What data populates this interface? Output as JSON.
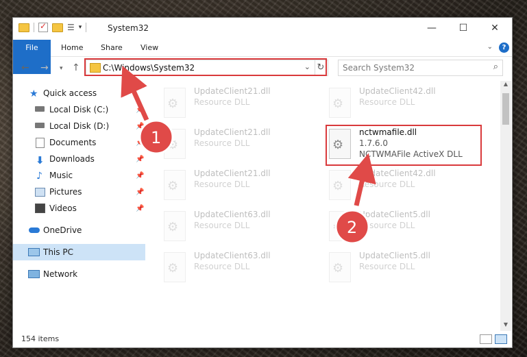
{
  "window": {
    "title": "System32"
  },
  "ribbon": {
    "tabs": [
      "File",
      "Home",
      "Share",
      "View"
    ],
    "help": "?"
  },
  "address": {
    "path": "C:\\Windows\\System32",
    "search_placeholder": "Search System32"
  },
  "sidebar": {
    "items": [
      {
        "label": "Quick access",
        "icon": "star-icon"
      },
      {
        "label": "Local Disk (C:)",
        "icon": "drive-icon"
      },
      {
        "label": "Local Disk (D:)",
        "icon": "drive-icon"
      },
      {
        "label": "Documents",
        "icon": "documents-icon"
      },
      {
        "label": "Downloads",
        "icon": "download-icon"
      },
      {
        "label": "Music",
        "icon": "music-icon"
      },
      {
        "label": "Pictures",
        "icon": "pictures-icon"
      },
      {
        "label": "Videos",
        "icon": "videos-icon"
      },
      {
        "label": "OneDrive",
        "icon": "cloud-icon"
      },
      {
        "label": "This PC",
        "icon": "computer-icon"
      },
      {
        "label": "Network",
        "icon": "network-icon"
      }
    ]
  },
  "files": {
    "ghost_left": [
      {
        "name": "UpdateClient21.dll",
        "desc": "Resource DLL"
      },
      {
        "name": "UpdateClient21.dll",
        "desc": "Resource DLL"
      },
      {
        "name": "UpdateClient21.dll",
        "desc": "Resource DLL"
      },
      {
        "name": "UpdateClient63.dll",
        "desc": "Resource DLL"
      },
      {
        "name": "UpdateClient63.dll",
        "desc": "Resource DLL"
      }
    ],
    "ghost_right": [
      {
        "name": "UpdateClient42.dll",
        "desc": "Resource DLL"
      },
      {
        "name": "UpdateClient42.dll",
        "desc": "Resource DLL"
      },
      {
        "name": "UpdateClient5.dll",
        "desc": "Resource DLL"
      },
      {
        "name": "UpdateClient5.dll",
        "desc": "Resource DLL"
      }
    ],
    "highlight": {
      "name": "nctwmafile.dll",
      "version": "1.7.6.0",
      "desc": "NCTWMAFile ActiveX DLL"
    }
  },
  "status": {
    "count": "154 items"
  },
  "annotations": {
    "step1": "1",
    "step2": "2"
  },
  "colors": {
    "accent": "#1e6ec8",
    "highlight_red": "#d9393b"
  }
}
